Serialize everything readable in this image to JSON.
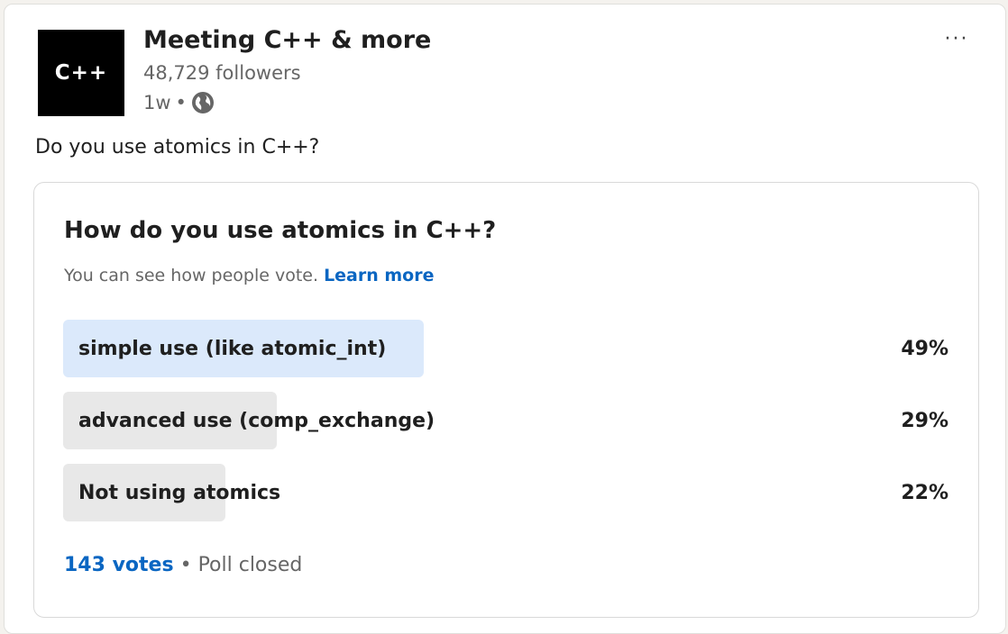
{
  "post": {
    "logo_text": "C++",
    "org_name": "Meeting C++ & more",
    "followers": "48,729 followers",
    "age": "1w",
    "separator": "•",
    "visibility_icon": "globe-icon",
    "more_icon": "ellipsis-icon",
    "more_label": "···",
    "text": "Do you use atomics in C++?"
  },
  "poll": {
    "question": "How do you use atomics in C++?",
    "note": "You can see how people vote.",
    "learn_more": "Learn more",
    "options": [
      {
        "label": "simple use (like atomic_int)",
        "percent_label": "49%",
        "fraction": 0.49,
        "selected": true
      },
      {
        "label": "advanced use (comp_exchange)",
        "percent_label": "29%",
        "fraction": 0.29,
        "selected": false
      },
      {
        "label": "Not using atomics",
        "percent_label": "22%",
        "fraction": 0.22,
        "selected": false
      }
    ],
    "votes": "143 votes",
    "separator": "•",
    "status": "Poll closed"
  },
  "colors": {
    "accent": "#0a66c2",
    "selected_bar": "#dbe9fb",
    "unselected_bar": "#e8e8e8"
  }
}
